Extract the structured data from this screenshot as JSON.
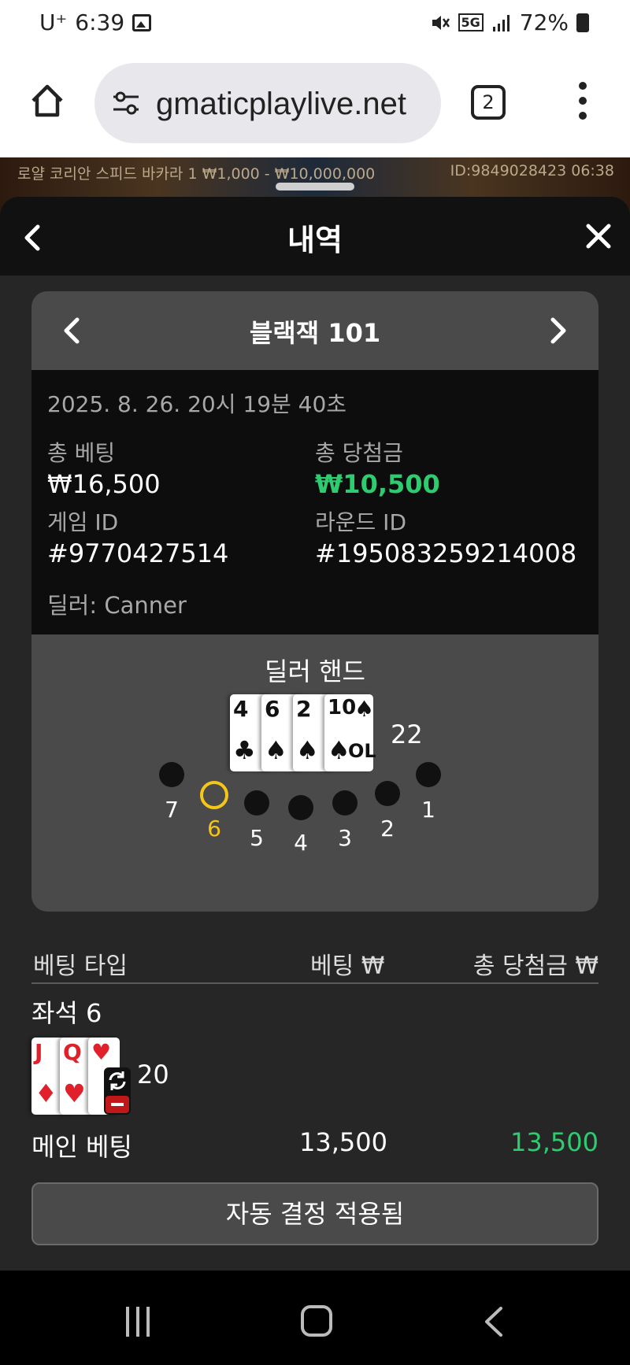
{
  "status_bar": {
    "carrier": "U⁺",
    "time": "6:39",
    "network": "5G",
    "battery": "72%"
  },
  "browser": {
    "url": "gmaticplaylive.net",
    "tab_count": "2"
  },
  "game_strip": {
    "info_left": "로얄 코리안 스피드 바카라 1  ₩1,000 - ₩10,000,000",
    "info_right": "ID:9849028423  06:38"
  },
  "sheet": {
    "title": "내역"
  },
  "round": {
    "game_title": "블랙잭 101",
    "datetime": "2025. 8. 26. 20시 19분 40초",
    "total_bet_label": "총 베팅",
    "total_bet_value": "₩16,500",
    "total_win_label": "총 당첨금",
    "total_win_value": "₩10,500",
    "game_id_label": "게임 ID",
    "game_id_value": "#9770427514",
    "round_id_label": "라운드 ID",
    "round_id_value": "#195083259214008",
    "dealer": "딜러: Canner"
  },
  "dealer_hand": {
    "title": "딜러 핸드",
    "cards": [
      {
        "rank": "4",
        "suit": "♣",
        "color": "#111111"
      },
      {
        "rank": "6",
        "suit": "♠",
        "color": "#111111"
      },
      {
        "rank": "2",
        "suit": "♠",
        "color": "#111111"
      },
      {
        "rank": "10",
        "suit": "♠",
        "color": "#111111"
      }
    ],
    "card_corner_text": "OL",
    "total": "22"
  },
  "seats": [
    "7",
    "6",
    "5",
    "4",
    "3",
    "2",
    "1"
  ],
  "active_seat": "6",
  "bets": {
    "col_type": "베팅 타입",
    "col_bet": "베팅 ₩",
    "col_win": "총 당첨금 ₩",
    "seat_label": "좌석 6",
    "player_cards": [
      {
        "rank": "J",
        "suit": "♦",
        "color": "#e0202a"
      },
      {
        "rank": "Q",
        "suit": "♥",
        "color": "#e0202a"
      },
      {
        "rank": "",
        "suit": "♥",
        "color": "#e0202a"
      }
    ],
    "player_total": "20",
    "main_bet_label": "메인 베팅",
    "main_bet_stake": "13,500",
    "main_bet_win": "13,500",
    "auto_decision": "자동 결정 적용됨"
  },
  "colors": {
    "win_green": "#2ecc71",
    "active_seat": "#f5c518",
    "sheet_bg": "#262626"
  }
}
